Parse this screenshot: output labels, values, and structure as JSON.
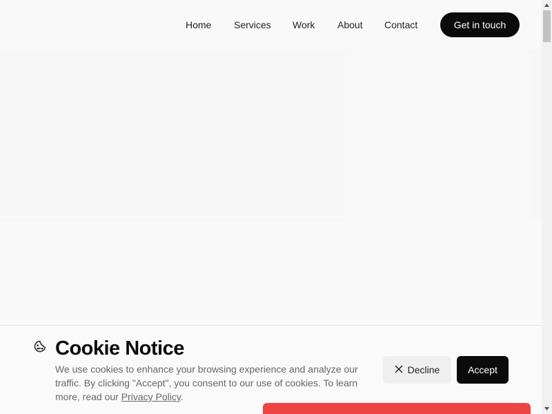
{
  "nav": {
    "links": [
      "Home",
      "Services",
      "Work",
      "About",
      "Contact"
    ],
    "cta_label": "Get in touch"
  },
  "cookie": {
    "icon": "cookie-icon",
    "title": "Cookie Notice",
    "text_before_link": "We use cookies to enhance your browsing experience and analyze our traffic. By clicking \"Accept\", you consent to our use of cookies. To learn more, read our ",
    "link_label": "Privacy Policy",
    "text_after_link": ".",
    "decline_label": "Decline",
    "decline_icon": "close-icon",
    "accept_label": "Accept"
  },
  "colors": {
    "accent_dark": "#0b0b0b",
    "alert_red": "#ef4444"
  }
}
